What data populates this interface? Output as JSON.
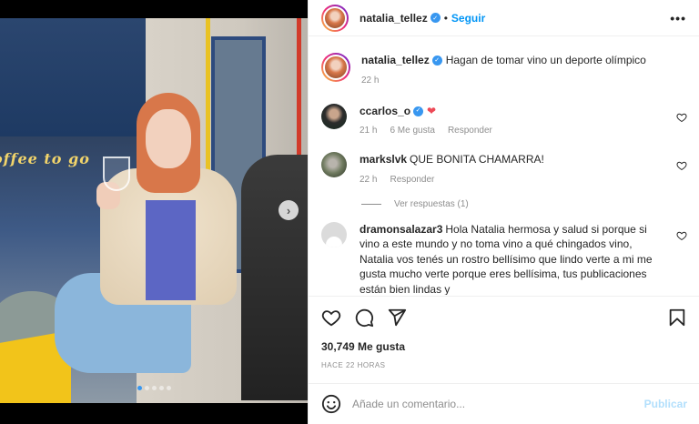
{
  "post": {
    "author": "natalia_tellez",
    "follow_label": "Seguir",
    "more_label": "•••",
    "caption": {
      "username": "natalia_tellez",
      "text": "Hagan de tomar vino un deporte olímpico",
      "time": "22 h"
    },
    "photo_sign_text": "offee to go",
    "carousel": {
      "active_index": 0,
      "count": 5,
      "next_icon": "chevron-right-icon"
    }
  },
  "comments": [
    {
      "username": "ccarlos_o",
      "verified": true,
      "text": "❤",
      "time": "21 h",
      "likes": "6 Me gusta",
      "reply_label": "Responder"
    },
    {
      "username": "markslvk",
      "verified": false,
      "text": "QUE BONITA CHAMARRA!",
      "time": "22 h",
      "reply_label": "Responder"
    },
    {
      "username": "dramonsalazar3",
      "verified": false,
      "text": "Hola Natalia hermosa y salud si porque si vino a este mundo y no toma vino a qué chingados vino, Natalia vos tenés un rostro bellísimo que lindo verte a mi me gusta mucho verte porque eres bellísima, tus publicaciones están bien lindas y"
    }
  ],
  "view_replies_label": "Ver respuestas (1)",
  "stats": {
    "likes_label": "30,749 Me gusta",
    "time_ago": "HACE 22 HORAS"
  },
  "add_comment": {
    "placeholder": "Añade un comentario...",
    "publish_label": "Publicar"
  },
  "colors": {
    "link_blue": "#0095f6",
    "verified_blue": "#3897f0",
    "muted": "#8e8e8e",
    "heart_red": "#ed4956",
    "publish_disabled": "#b2dffc"
  },
  "icons": [
    "like-icon",
    "comment-icon",
    "share-icon",
    "save-icon",
    "emoji-icon",
    "heart-icon",
    "verified-icon",
    "more-icon"
  ]
}
